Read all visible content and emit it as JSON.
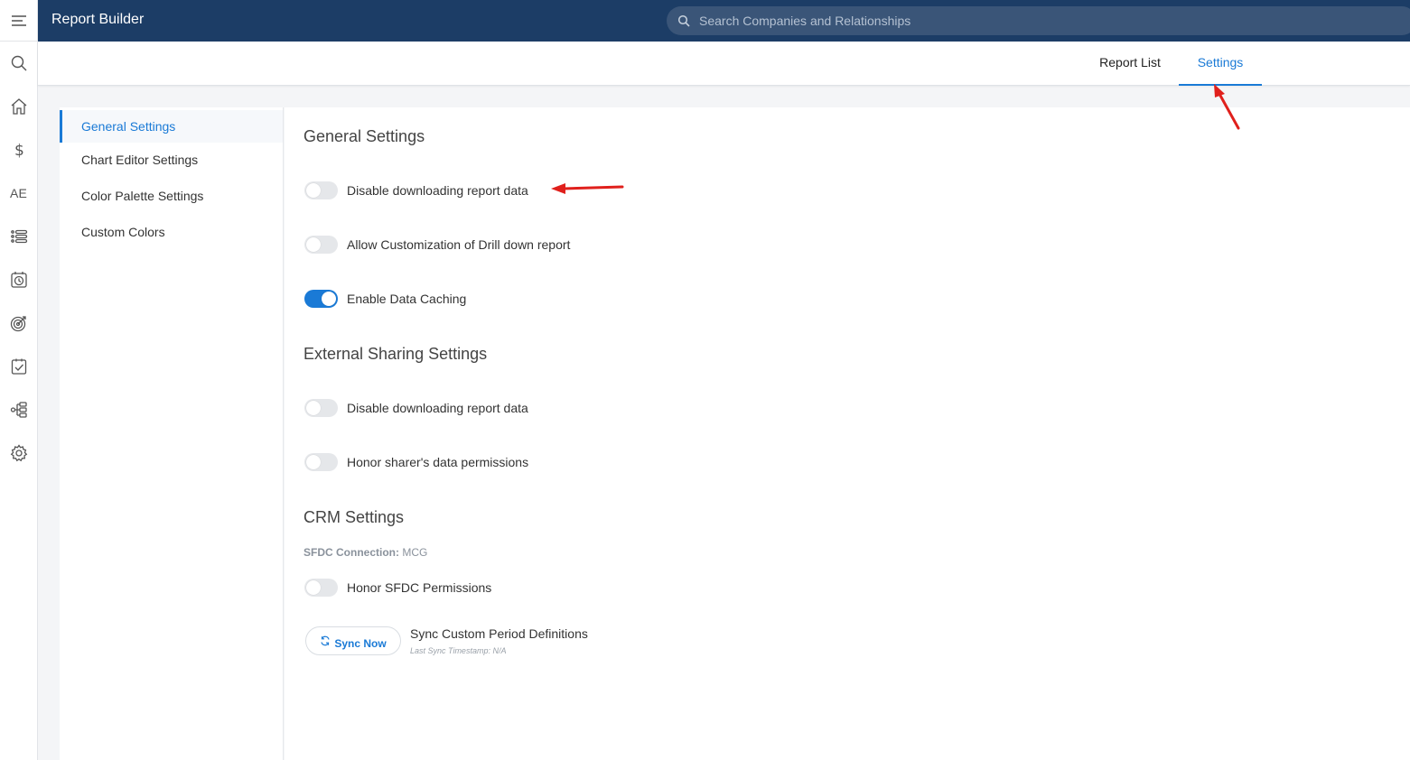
{
  "app": {
    "title": "Report Builder"
  },
  "search": {
    "placeholder": "Search Companies and Relationships"
  },
  "rail": {
    "icons": [
      "menu-icon",
      "search-icon",
      "home-icon",
      "dollar-icon",
      "AE",
      "list-icon",
      "alarm-clock-icon",
      "target-icon",
      "clipboard-check-icon",
      "hierarchy-icon",
      "gear-icon"
    ],
    "ae_label": "AE"
  },
  "tabs": [
    {
      "label": "Report List",
      "active": false
    },
    {
      "label": "Settings",
      "active": true
    }
  ],
  "sidenav": {
    "items": [
      {
        "label": "General Settings",
        "active": true
      },
      {
        "label": "Chart Editor Settings",
        "active": false
      },
      {
        "label": "Color Palette Settings",
        "active": false
      },
      {
        "label": "Custom Colors",
        "active": false
      }
    ]
  },
  "general": {
    "title": "General Settings",
    "toggles": [
      {
        "label": "Disable downloading report data",
        "on": false
      },
      {
        "label": "Allow Customization of Drill down report",
        "on": false
      },
      {
        "label": "Enable Data Caching",
        "on": true
      }
    ]
  },
  "external": {
    "title": "External Sharing Settings",
    "toggles": [
      {
        "label": "Disable downloading report data",
        "on": false
      },
      {
        "label": "Honor sharer's data permissions",
        "on": false
      }
    ]
  },
  "crm": {
    "title": "CRM Settings",
    "connection_label": "SFDC Connection:",
    "connection_value": "MCG",
    "toggles": [
      {
        "label": "Honor SFDC Permissions",
        "on": false
      }
    ],
    "sync_button": "Sync Now",
    "sync_title": "Sync Custom Period Definitions",
    "sync_timestamp": "Last Sync Timestamp: N/A"
  },
  "colors": {
    "header": "#1c3d66",
    "accent": "#1a7ad6",
    "annotation": "#e0201c"
  }
}
